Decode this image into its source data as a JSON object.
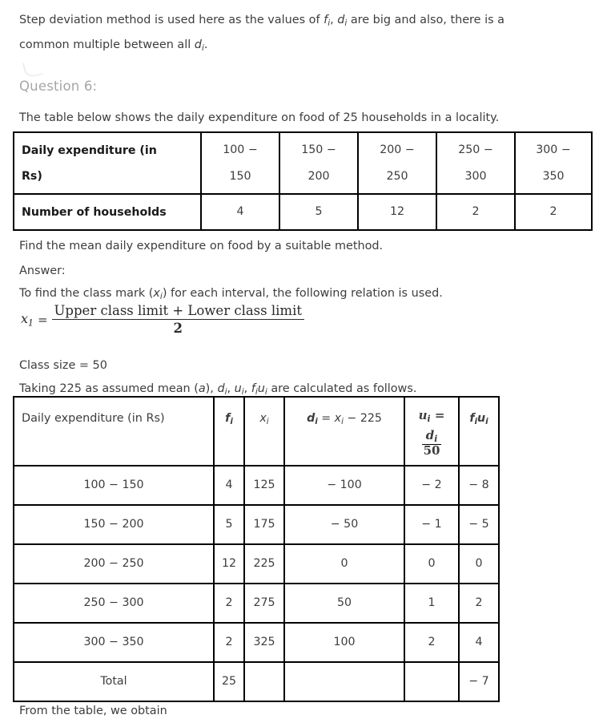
{
  "intro": {
    "line1_a": "Step deviation method is used here as the values of ",
    "line1_f": "f",
    "line1_b": ", ",
    "line1_d": "d",
    "line1_c": " are big and also, there is a",
    "line2_a": "common multiple between all ",
    "line2_d": "d",
    "line2_b": "."
  },
  "question": {
    "label": "Question 6:",
    "statement": "The table below shows the daily expenditure on food of 25 households in a locality.",
    "find": "Find the mean daily expenditure on food by a suitable method.",
    "answer_label": "Answer:"
  },
  "classmark": {
    "intro_a": "To find the class mark (",
    "intro_x": "x",
    "intro_b": ") for each interval, the following relation is used.",
    "lhs": "x",
    "lhs_sub": "1",
    "equals": "=",
    "numerator": "Upper class limit + Lower class limit",
    "denominator": "2",
    "class_size": "Class size = 50",
    "assumed_a": "Taking 225 as assumed mean (",
    "assumed_a_var": "a",
    "assumed_b": "), ",
    "assumed_d": "d",
    "assumed_u": "u",
    "assumed_fu_f": "f",
    "assumed_fu_u": "u",
    "assumed_c": " are calculated as follows."
  },
  "table_expenditure": {
    "row_label_1": "Daily expenditure (in Rs)",
    "row_label_2": "Number of households",
    "intervals": [
      "100 − 150",
      "150 − 200",
      "200 − 250",
      "250 − 300",
      "300 − 350"
    ],
    "intervals_upper": [
      "100 −",
      "150 −",
      "200 −",
      "250 −",
      "300 −"
    ],
    "intervals_lower": [
      "150",
      "200",
      "250",
      "300",
      "350"
    ],
    "households": [
      "4",
      "5",
      "12",
      "2",
      "2"
    ]
  },
  "table_calc": {
    "headers": {
      "interval": "Daily expenditure (in Rs)",
      "f": "f",
      "x": "x",
      "d_lead": "d",
      "d_eq": " = ",
      "d_x": "x",
      "d_rest": " − 225",
      "u_lead": "u",
      "u_eq": "=",
      "u_num": "d",
      "u_den": "50",
      "fu_f": "f",
      "fu_u": "u",
      "sub_i": "i"
    },
    "rows": [
      {
        "interval": "100 − 150",
        "f": "4",
        "x": "125",
        "d": "− 100",
        "u": "− 2",
        "fu": "− 8"
      },
      {
        "interval": "150 − 200",
        "f": "5",
        "x": "175",
        "d": "− 50",
        "u": "− 1",
        "fu": "− 5"
      },
      {
        "interval": "200 − 250",
        "f": "12",
        "x": "225",
        "d": "0",
        "u": "0",
        "fu": "0"
      },
      {
        "interval": "250 − 300",
        "f": "2",
        "x": "275",
        "d": "50",
        "u": "1",
        "fu": "2"
      },
      {
        "interval": "300 − 350",
        "f": "2",
        "x": "325",
        "d": "100",
        "u": "2",
        "fu": "4"
      }
    ],
    "total": {
      "interval": "Total",
      "f": "25",
      "x": "",
      "d": "",
      "u": "",
      "fu": "− 7"
    }
  },
  "footer": {
    "line": "From the table, we obtain"
  },
  "colors": {
    "body_text": "#3d3d3d",
    "question_label": "#a6a6a6",
    "table_border": "#000000",
    "background": "#ffffff"
  }
}
